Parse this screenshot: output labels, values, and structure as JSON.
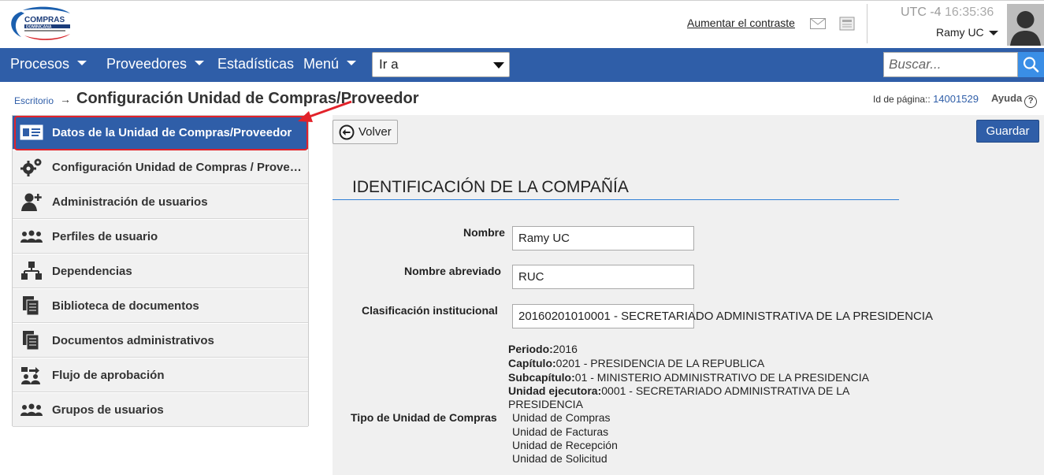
{
  "header": {
    "logo_text": "COMPRAS DOMINICANA",
    "contrast_link": "Aumentar el contraste",
    "timezone": "UTC -4",
    "time": "16:35:36",
    "user_name": "Ramy UC"
  },
  "nav": {
    "items": [
      "Procesos",
      "Proveedores",
      "Estadísticas",
      "Menú"
    ],
    "goto_value": "Ir a",
    "search_placeholder": "Buscar..."
  },
  "breadcrumb": {
    "home": "Escritorio",
    "arrow": "→",
    "title": "Configuración Unidad de Compras/Proveedor"
  },
  "page_info": {
    "id_label": "Id de página::",
    "id_value": "14001529",
    "help_label": "Ayuda",
    "help_symbol": "?"
  },
  "sidebar": {
    "items": [
      {
        "label": "Datos de la Unidad de Compras/Proveedor",
        "icon": "id-card-icon",
        "active": true
      },
      {
        "label": "Configuración Unidad de Compras / Proveedor",
        "icon": "gears-icon",
        "active": false
      },
      {
        "label": "Administración de usuarios",
        "icon": "user-add-icon",
        "active": false
      },
      {
        "label": "Perfiles de usuario",
        "icon": "users-profile-icon",
        "active": false
      },
      {
        "label": "Dependencias",
        "icon": "org-chart-icon",
        "active": false
      },
      {
        "label": "Biblioteca de documentos",
        "icon": "documents-icon",
        "active": false
      },
      {
        "label": "Documentos administrativos",
        "icon": "documents-icon",
        "active": false
      },
      {
        "label": "Flujo de aprobación",
        "icon": "approval-flow-icon",
        "active": false
      },
      {
        "label": "Grupos de usuarios",
        "icon": "user-group-icon",
        "active": false
      }
    ]
  },
  "toolbar": {
    "back_label": "Volver",
    "save_label": "Guardar"
  },
  "form": {
    "section_title": "IDENTIFICACIÓN DE LA COMPAÑÍA",
    "name_label": "Nombre",
    "name_value": "Ramy UC",
    "short_name_label": "Nombre abreviado",
    "short_name_value": "RUC",
    "classification_label": "Clasificación institucional",
    "classification_value": "20160201010001 - SECRETARIADO ADMINISTRATIVA DE LA PRESIDENCIA",
    "period_label": "Periodo:",
    "period_value": "2016",
    "chapter_label": "Capítulo:",
    "chapter_value": "0201 - PRESIDENCIA DE LA REPUBLICA",
    "subchapter_label": "Subcapítulo:",
    "subchapter_value": "01 - MINISTERIO ADMINISTRATIVO DE LA PRESIDENCIA",
    "exec_unit_label": "Unidad ejecutora:",
    "exec_unit_value": "0001 - SECRETARIADO ADMINISTRATIVA DE LA",
    "exec_unit_value_cont": "PRESIDENCIA",
    "unit_type_label": "Tipo de Unidad de Compras",
    "unit_types": [
      "Unidad de Compras",
      "Unidad de Facturas",
      "Unidad de Recepción",
      "Unidad de Solicitud"
    ]
  },
  "colors": {
    "nav_blue": "#2f5ea8",
    "accent_line": "#2f7fd6",
    "highlight_red": "#e2222a"
  }
}
